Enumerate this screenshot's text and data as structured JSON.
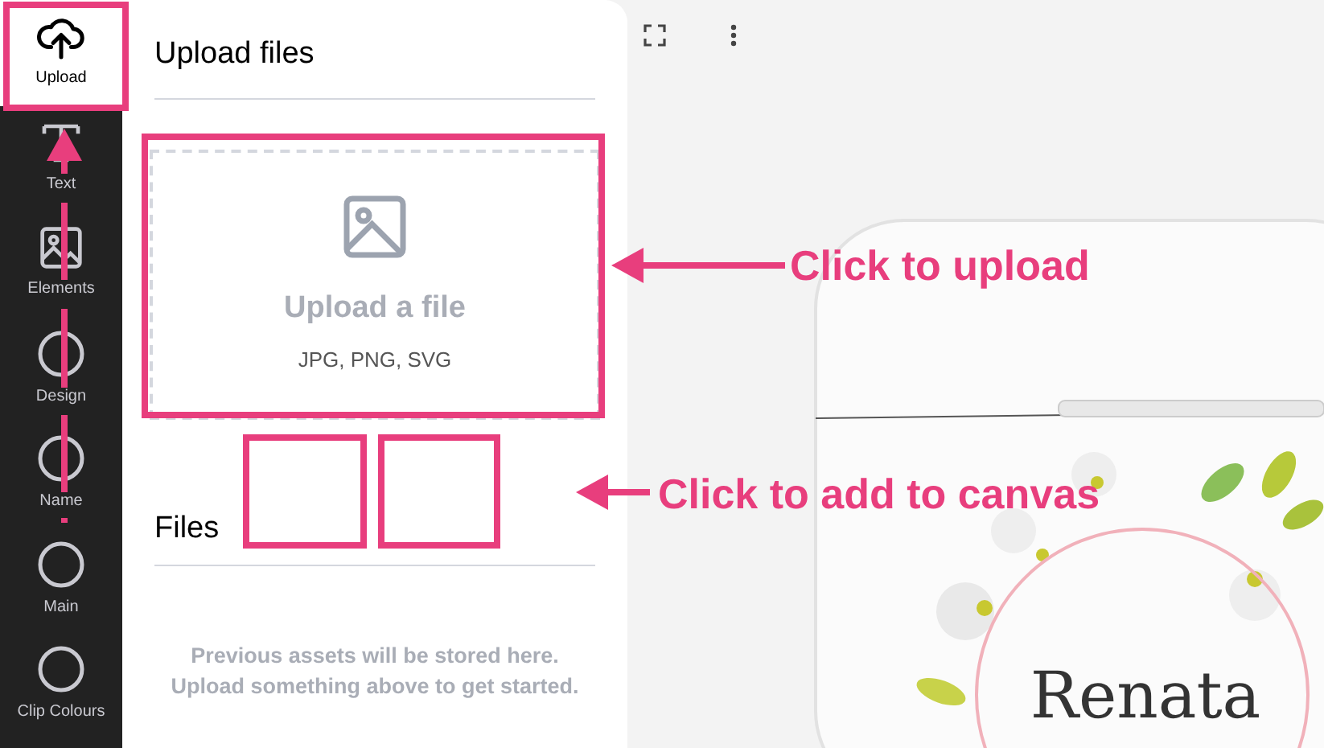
{
  "sidebar": {
    "items": [
      {
        "label": "Upload",
        "kind": "upload",
        "selected": true
      },
      {
        "label": "Text",
        "kind": "text",
        "selected": false
      },
      {
        "label": "Elements",
        "kind": "image",
        "selected": false
      },
      {
        "label": "Design",
        "kind": "shape",
        "selected": false
      },
      {
        "label": "Name",
        "kind": "shape",
        "selected": false
      },
      {
        "label": "Main",
        "kind": "shape",
        "selected": false
      },
      {
        "label": "Clip Colours",
        "kind": "shape",
        "selected": false
      }
    ]
  },
  "panel": {
    "title": "Upload files",
    "dropzone": {
      "title": "Upload a file",
      "formats": "JPG, PNG, SVG"
    },
    "files_label": "Files",
    "empty_message": "Previous assets will be stored here. Upload something above to get started."
  },
  "canvas": {
    "product_name": "Renata"
  },
  "annotations": [
    {
      "kind": "callout",
      "text": "Click to upload"
    },
    {
      "kind": "callout",
      "text": "Click to add to canvas"
    }
  ]
}
